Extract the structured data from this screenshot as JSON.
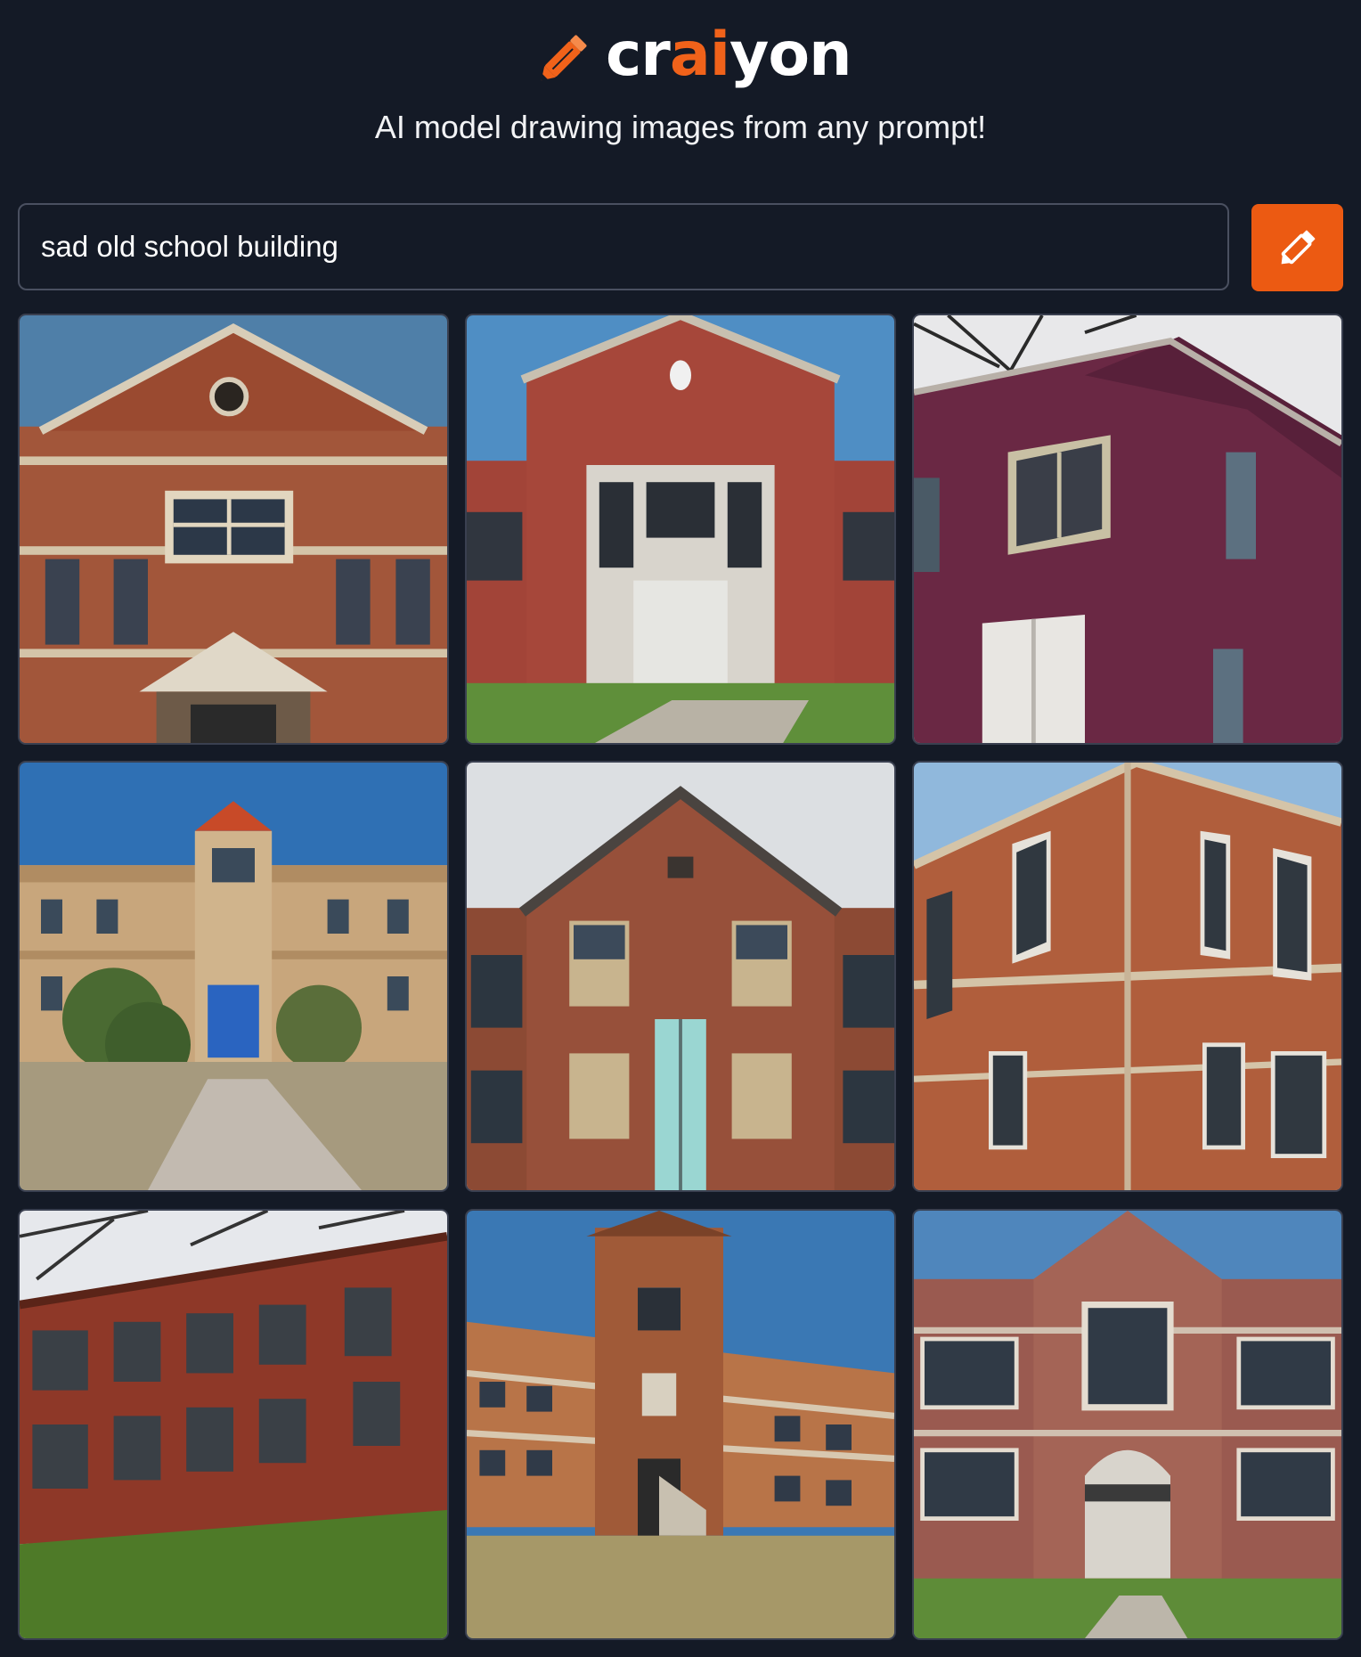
{
  "brand": {
    "logo_prefix": "cr",
    "logo_accent": "ai",
    "logo_suffix": "yon",
    "accent_color": "#f0621a",
    "logo_icon": "pencil-icon"
  },
  "tagline": "AI model drawing images from any prompt!",
  "search": {
    "value": "sad old school building",
    "button_icon": "pencil-icon",
    "button_color": "#ec5a12"
  },
  "results": [
    {
      "scene": "brick-school-gable-front"
    },
    {
      "scene": "brick-school-center-entrance"
    },
    {
      "scene": "purple-brick-corner-building"
    },
    {
      "scene": "school-with-tower-and-path"
    },
    {
      "scene": "gothic-brick-school-front"
    },
    {
      "scene": "brick-school-corner-perspective"
    },
    {
      "scene": "long-brick-facade-with-trees"
    },
    {
      "scene": "brick-school-central-tower-field"
    },
    {
      "scene": "brick-school-arched-entrance"
    }
  ],
  "colors": {
    "background": "#141a26",
    "input_border": "#4a5060"
  }
}
